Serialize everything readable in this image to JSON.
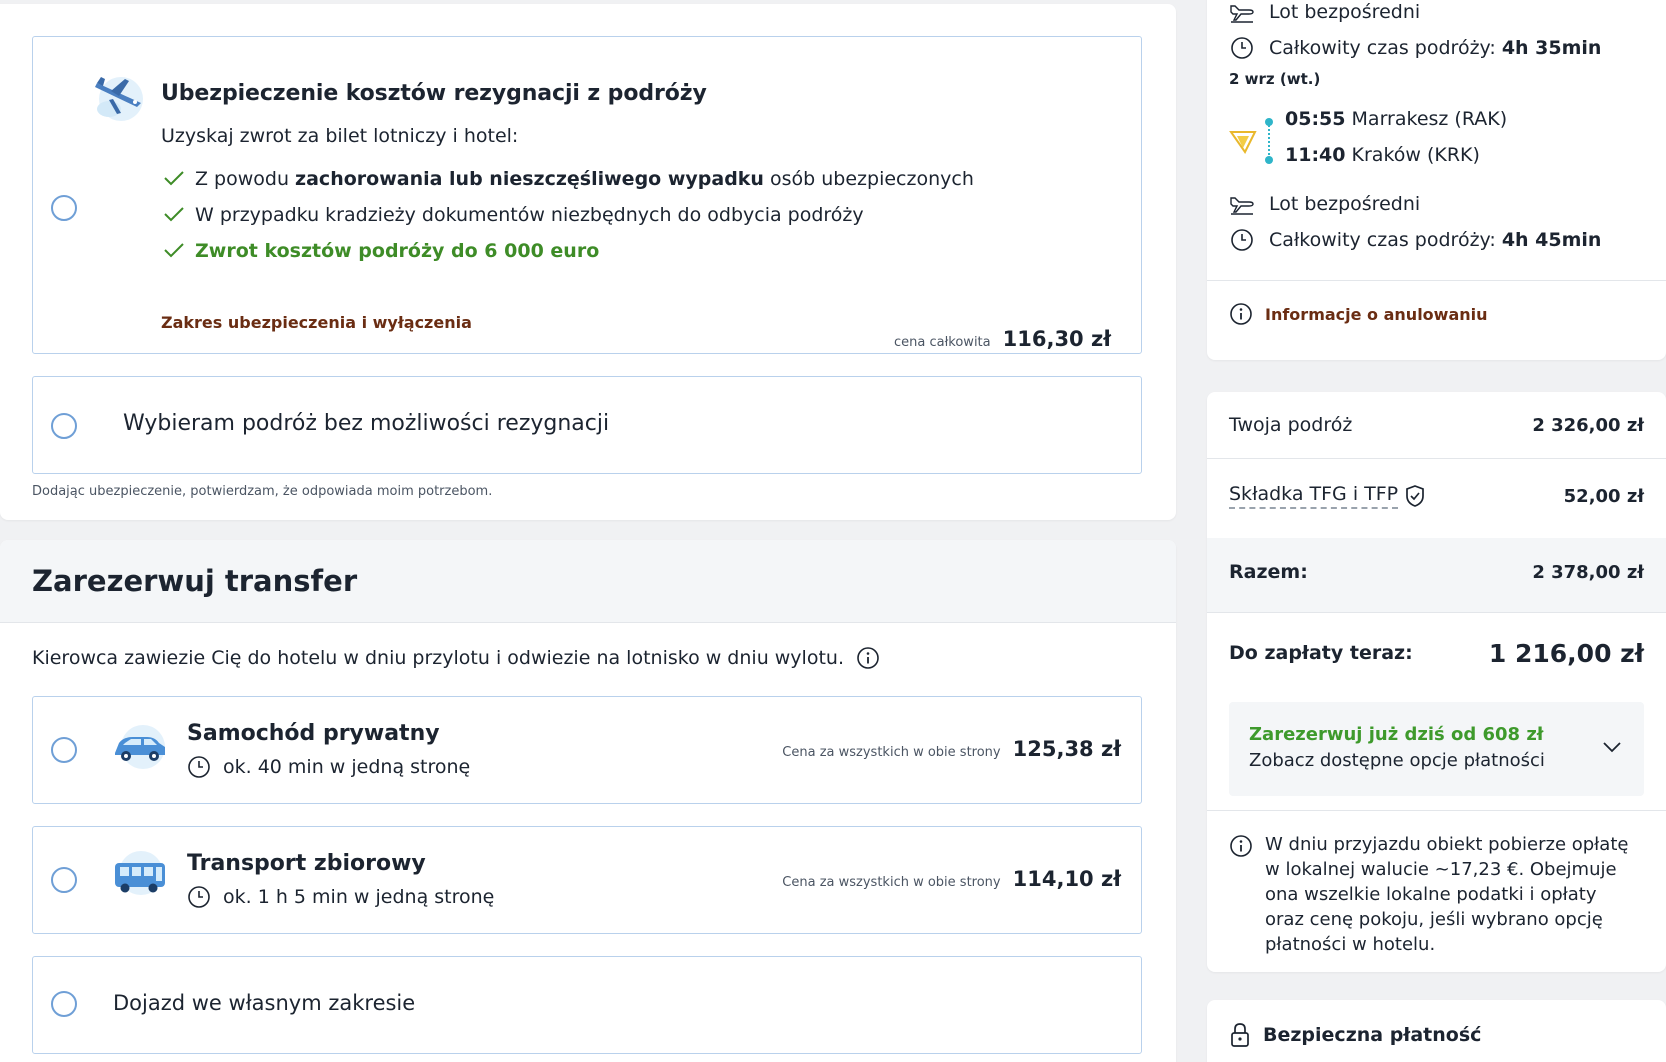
{
  "insurance": {
    "title": "Ubezpieczenie kosztów rezygnacji z podróży",
    "subtitle": "Uzyskaj zwrot za bilet lotniczy i hotel:",
    "items": [
      {
        "pre": "Z powodu ",
        "bold": "zachorowania lub nieszczęśliwego wypadku",
        "post": " osób ubezpieczonych"
      },
      {
        "pre": "W przypadku kradzieży dokumentów niezbędnych do odbycia podróży",
        "bold": "",
        "post": ""
      },
      {
        "pre": "",
        "bold": "Zwrot kosztów podróży do 6 000 euro",
        "post": ""
      }
    ],
    "range_link": "Zakres ubezpieczenia i wyłączenia",
    "price_label": "cena całkowita",
    "price": "116,30 zł",
    "no_insurance_label": "Wybieram podróż bez możliwości rezygnacji",
    "consent_note": "Dodając ubezpieczenie, potwierdzam, że odpowiada moim potrzebom."
  },
  "transfer": {
    "title": "Zarezerwuj transfer",
    "description": "Kierowca zawiezie Cię do hotelu w dniu przylotu i odwiezie na lotnisko w dniu wylotu.",
    "options": [
      {
        "name": "Samochód prywatny",
        "duration": "ok. 40 min w jedną stronę",
        "price_label": "Cena za wszystkich w obie strony",
        "price": "125,38 zł"
      },
      {
        "name": "Transport zbiorowy",
        "duration": "ok. 1 h 5 min w jedną stronę",
        "price_label": "Cena za wszystkich w obie strony",
        "price": "114,10 zł"
      }
    ],
    "own_label": "Dojazd we własnym zakresie"
  },
  "flight": {
    "direct_1": "Lot bezpośredni",
    "total_label_1": "Całkowity czas podróży:",
    "total_value_1": "4h 35min",
    "return_date": "2 wrz (wt.)",
    "dep_time": "05:55",
    "dep_place": "Marrakesz (RAK)",
    "arr_time": "11:40",
    "arr_place": "Kraków (KRK)",
    "direct_2": "Lot bezpośredni",
    "total_label_2": "Całkowity czas podróży:",
    "total_value_2": "4h 45min",
    "cancel_info": "Informacje o anulowaniu"
  },
  "summary": {
    "trip_label": "Twoja podróż",
    "trip_value": "2 326,00 zł",
    "tfg_label": "Składka TFG i TFP",
    "tfg_value": "52,00 zł",
    "total_label": "Razem:",
    "total_value": "2 378,00 zł",
    "pay_now_label": "Do zapłaty teraz:",
    "pay_now_value": "1 216,00 zł",
    "installments_title": "Zarezerwuj już dziś od 608 zł",
    "installments_sub": "Zobacz dostępne opcje płatności",
    "local_fee": "W dniu przyjazdu obiekt pobierze opłatę w lokalnej walucie ~17,23 €. Obejmuje ona wszelkie lokalne podatki i opłaty oraz cenę pokoju, jeśli wybrano opcję płatności w hotelu.",
    "secure_payment": "Bezpieczna płatność"
  },
  "colors": {
    "accent_green": "#3e8c27",
    "link_brown": "#6a2d13",
    "radio_blue": "#6f9fd6",
    "card_border": "#b9d1ec",
    "timeline_teal": "#2fb5c9"
  },
  "icons": [
    "plane-insurance-illustration",
    "check-icon",
    "info-icon",
    "clock-icon",
    "car-illustration",
    "bus-illustration",
    "plane-landing-icon",
    "airline-logo",
    "chevron-down-icon",
    "shield-check-icon",
    "lock-icon"
  ]
}
